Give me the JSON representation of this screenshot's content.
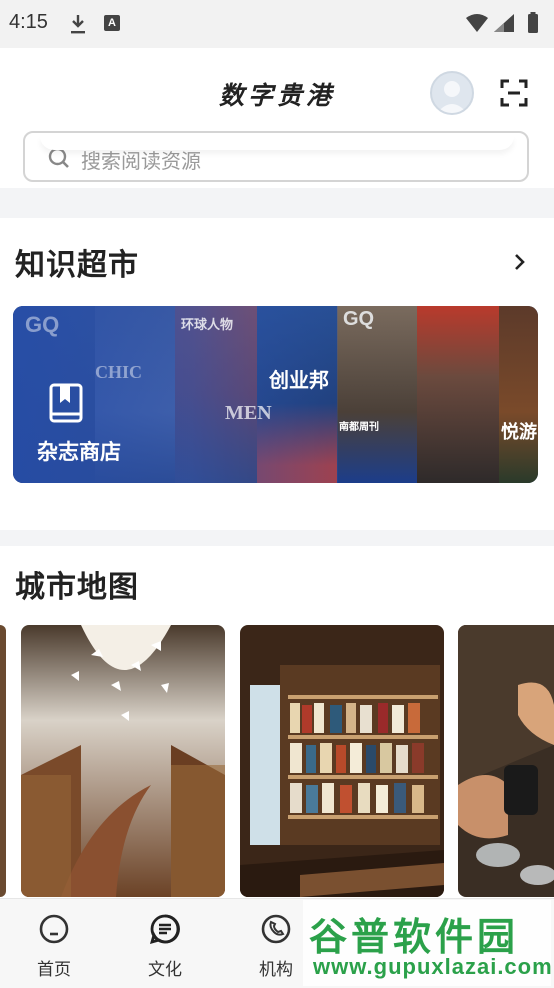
{
  "status_bar": {
    "time": "4:15",
    "download_icon": "download-icon",
    "notification_letter": "A"
  },
  "header": {
    "app_title": "数字贵港",
    "search_placeholder": "搜索阅读资源"
  },
  "knowledge_market": {
    "title": "知识超市",
    "banner_label": "杂志商店",
    "banner_magazine_words": [
      "GQ",
      "环球人物",
      "CHIC",
      "MEN",
      "创业邦",
      "GQ",
      "南都周刊",
      "悦游"
    ]
  },
  "city_map": {
    "title": "城市地图"
  },
  "bottom_nav": {
    "items": [
      {
        "label": "首页",
        "icon": "home-icon"
      },
      {
        "label": "文化",
        "icon": "culture-icon"
      },
      {
        "label": "机构",
        "icon": "institution-icon"
      }
    ]
  },
  "watermark": {
    "main": "谷普软件园",
    "url": "www.gupuxlazai.com"
  },
  "colors": {
    "banner_blue": "#2f5bb8",
    "watermark_green": "#2ba14a"
  }
}
